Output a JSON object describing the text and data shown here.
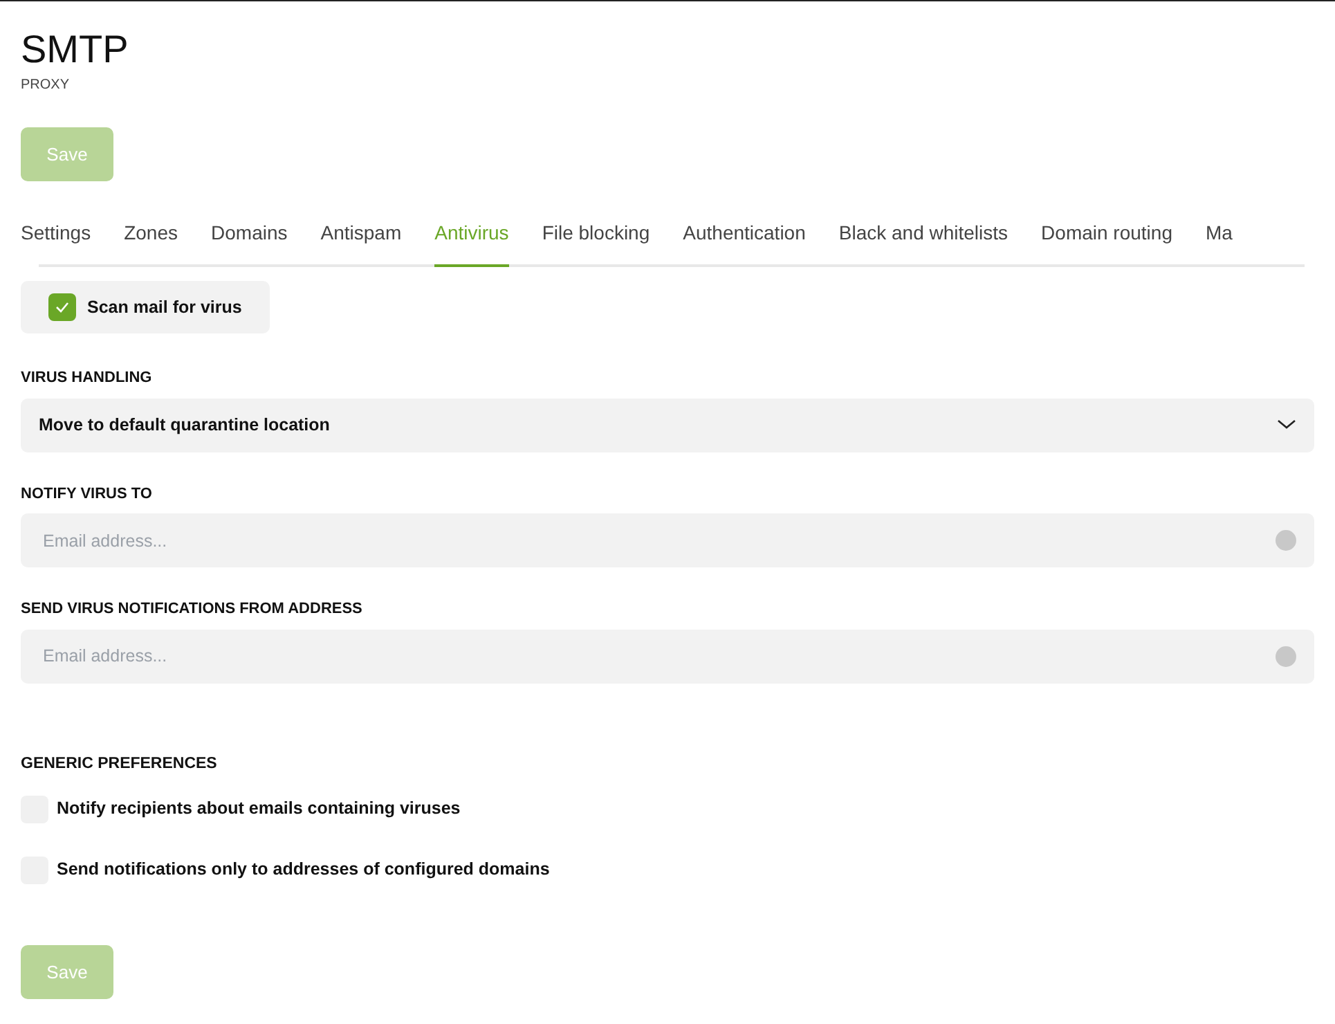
{
  "header": {
    "title": "SMTP",
    "subtitle": "PROXY"
  },
  "top_save": {
    "label": "Save",
    "disabled": true
  },
  "tabs": [
    {
      "label": "Settings",
      "selected": false
    },
    {
      "label": "Zones",
      "selected": false
    },
    {
      "label": "Domains",
      "selected": false
    },
    {
      "label": "Antispam",
      "selected": false
    },
    {
      "label": "Antivirus",
      "selected": true
    },
    {
      "label": "File blocking",
      "selected": false
    },
    {
      "label": "Authentication",
      "selected": false
    },
    {
      "label": "Black and whitelists",
      "selected": false
    },
    {
      "label": "Domain routing",
      "selected": false
    },
    {
      "label": "Ma",
      "selected": false
    }
  ],
  "scan_toggle": {
    "label": "Scan mail for virus",
    "checked": true
  },
  "fields": [
    {
      "kind": "select",
      "label": "VIRUS HANDLING",
      "value": "Move to default quarantine location"
    },
    {
      "kind": "input",
      "label": "NOTIFY VIRUS TO",
      "placeholder": "Email address..."
    },
    {
      "kind": "input",
      "label": "SEND VIRUS NOTIFICATIONS FROM ADDRESS",
      "placeholder": "Email address..."
    }
  ],
  "preferences": {
    "title": "GENERIC PREFERENCES",
    "items": [
      {
        "label": "Notify recipients about emails containing viruses",
        "checked": false
      },
      {
        "label": "Send notifications only to addresses of configured domains",
        "checked": false
      }
    ]
  },
  "bottom_save": {
    "label": "Save",
    "disabled": true
  }
}
